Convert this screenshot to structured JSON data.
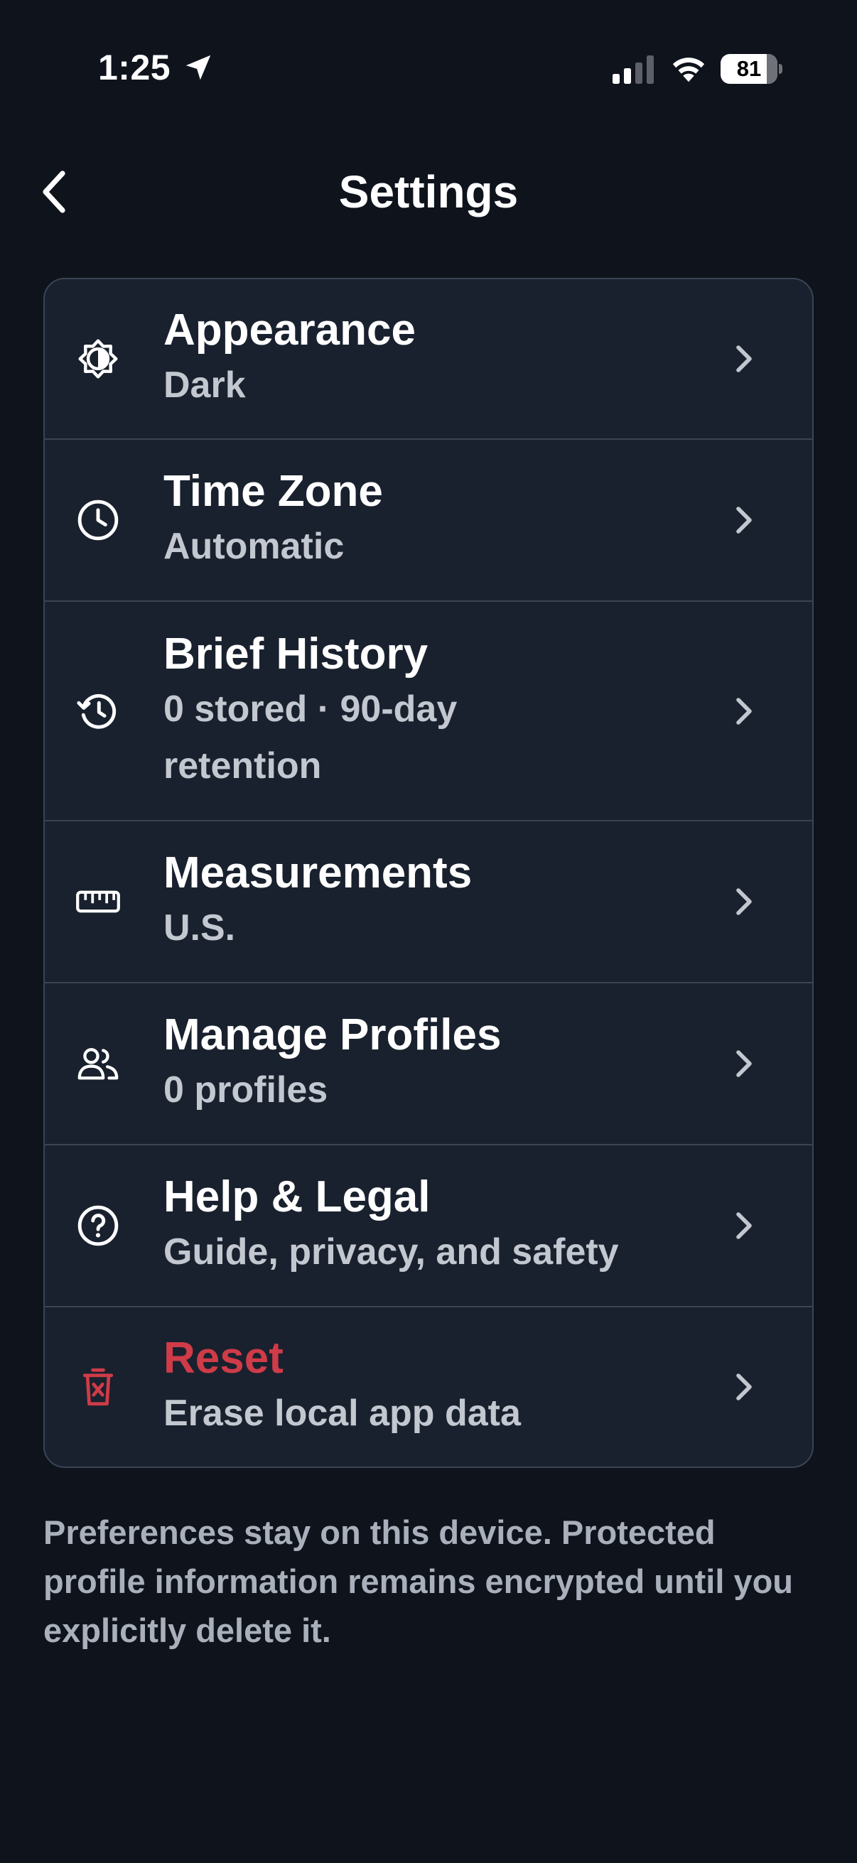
{
  "status_bar": {
    "time": "1:25",
    "battery": "81",
    "battery_level": 0.81
  },
  "nav": {
    "title": "Settings"
  },
  "settings": [
    {
      "id": "appearance",
      "icon": "appearance-icon",
      "title": "Appearance",
      "subtitle": "Dark"
    },
    {
      "id": "time-zone",
      "icon": "clock-icon",
      "title": "Time Zone",
      "subtitle": "Automatic"
    },
    {
      "id": "brief-history",
      "icon": "history-icon",
      "title": "Brief History",
      "subtitle": "0 stored · 90-day retention"
    },
    {
      "id": "measurements",
      "icon": "ruler-icon",
      "title": "Measurements",
      "subtitle": "U.S."
    },
    {
      "id": "manage-profiles",
      "icon": "people-icon",
      "title": "Manage Profiles",
      "subtitle": "0 profiles"
    },
    {
      "id": "help-legal",
      "icon": "help-icon",
      "title": "Help & Legal",
      "subtitle": "Guide, privacy, and safety"
    },
    {
      "id": "reset",
      "icon": "trash-icon",
      "title": "Reset",
      "subtitle": "Erase local app data",
      "danger": true
    }
  ],
  "footer": {
    "note": "Preferences stay on this device. Protected profile information remains encrypted until you explicitly delete it."
  },
  "colors": {
    "background": "#0e131c",
    "card": "#19212e",
    "danger": "#cf3b48"
  }
}
